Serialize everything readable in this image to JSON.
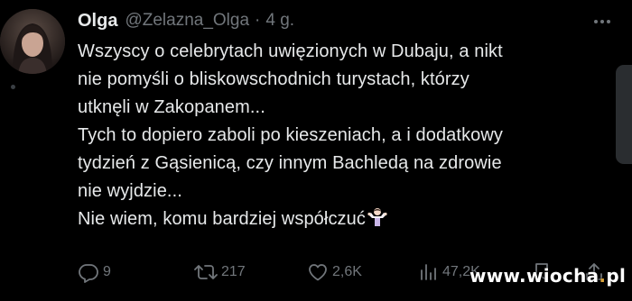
{
  "tweet": {
    "author_name": "Olga",
    "author_handle": "@Zelazna_Olga",
    "separator": "·",
    "time": "4 g.",
    "lines": [
      "Wszyscy o celebrytach uwięzionych w Dubaju, a nikt",
      "nie pomyśli o bliskowschodnich turystach, którzy",
      "utknęli w Zakopanem...",
      "Tych to dopiero zaboli po kieszeniach, a i dodatkowy",
      "tydzień z Gąsienicą, czy innym Bachledą na zdrowie",
      "nie wyjdzie...",
      "Nie wiem, komu bardziej współczuć"
    ],
    "emoji_icon": "person-shrugging-icon"
  },
  "actions": {
    "replies": "9",
    "reposts": "217",
    "likes": "2,6K",
    "views": "47,2K"
  },
  "watermark": {
    "prefix": "www.wiocha",
    "dot_accent": ".",
    "suffix": "pl"
  },
  "colors": {
    "background": "#000000",
    "text": "#e7e9ea",
    "muted": "#71767b"
  }
}
